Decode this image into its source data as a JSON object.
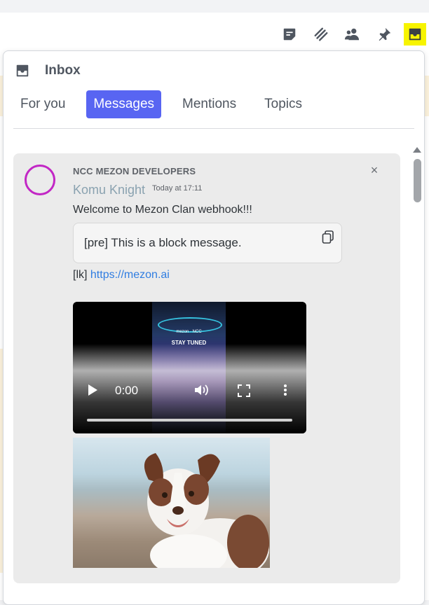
{
  "header": {
    "icons": [
      {
        "name": "threads-icon",
        "active": false
      },
      {
        "name": "channels-icon",
        "active": false
      },
      {
        "name": "members-icon",
        "active": false
      },
      {
        "name": "pin-icon",
        "active": false
      },
      {
        "name": "inbox-icon",
        "active": true
      }
    ],
    "active_color": "#f7f400"
  },
  "inbox": {
    "title": "Inbox",
    "tabs": [
      {
        "label": "For you",
        "active": false
      },
      {
        "label": "Messages",
        "active": true
      },
      {
        "label": "Mentions",
        "active": false
      },
      {
        "label": "Topics",
        "active": false
      }
    ],
    "accent": "#5865f2"
  },
  "message": {
    "clan": "NCC MEZON DEVELOPERS",
    "author": "Komu Knight",
    "time": "Today at 17:11",
    "text": "Welcome to Mezon Clan webhook!!!",
    "pre_block": "[pre] This is a block message.",
    "link_prefix": "[lk]",
    "link": "https://mezon.ai",
    "close_label": "×",
    "avatar_color": "#c227c5",
    "video": {
      "time": "0:00",
      "poster_brand": "mezon · NCC",
      "poster_text": "STAY TUNED"
    },
    "image": {
      "subject": "dog-photo"
    }
  }
}
